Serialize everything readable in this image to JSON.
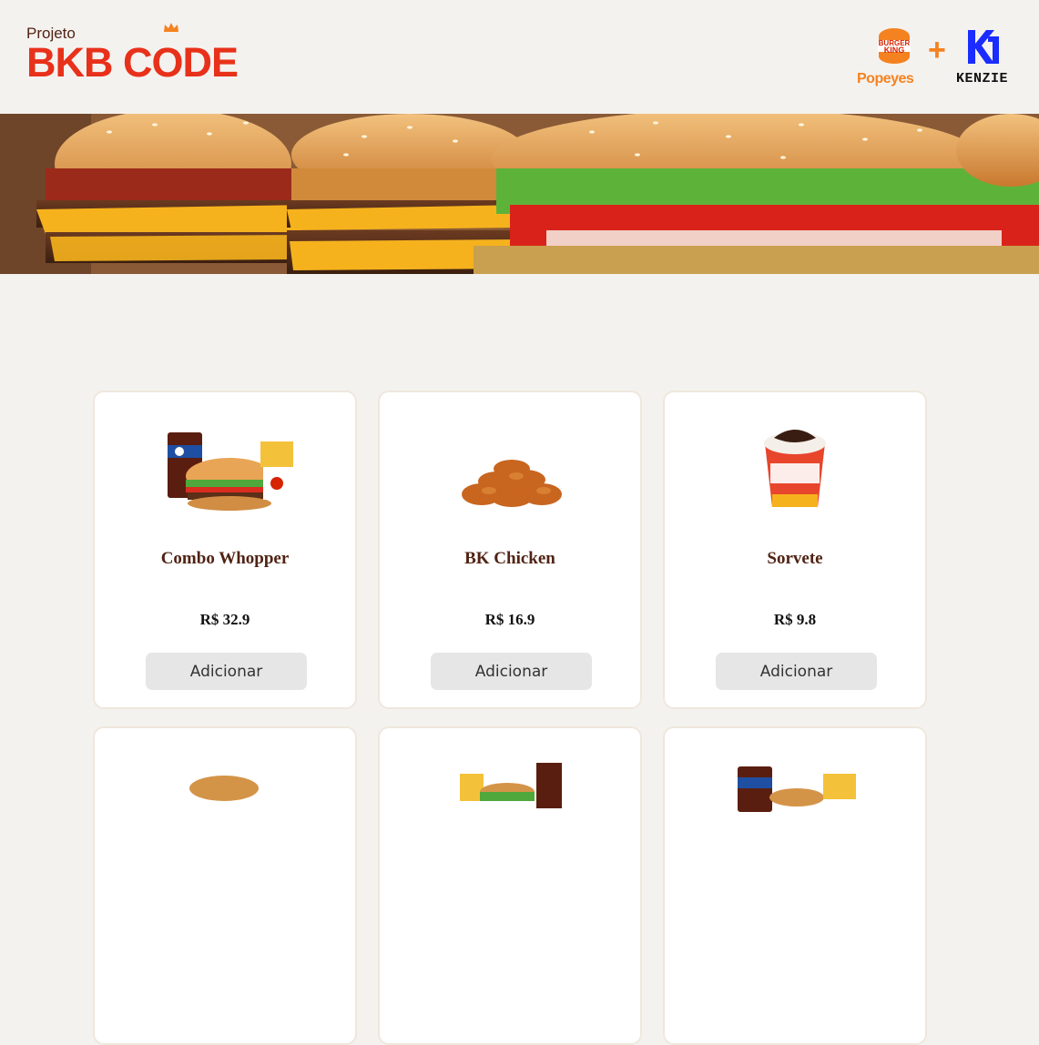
{
  "header": {
    "brand_small": "Projeto",
    "brand_large": "BKB CODE",
    "partner_bk": "BURGER KING",
    "partner_popeyes": "Popeyes",
    "partner_plus": "+",
    "partner_kenzie": "KENZIE"
  },
  "products": [
    {
      "name": "Combo Whopper",
      "price": "R$ 32.9",
      "button": "Adicionar",
      "image": "combo-whopper-image"
    },
    {
      "name": "BK Chicken",
      "price": "R$ 16.9",
      "button": "Adicionar",
      "image": "chicken-nuggets-image"
    },
    {
      "name": "Sorvete",
      "price": "R$ 9.8",
      "button": "Adicionar",
      "image": "sundae-image"
    },
    {
      "name": "",
      "price": "",
      "button": "",
      "image": "burger-image"
    },
    {
      "name": "",
      "price": "",
      "button": "",
      "image": "combo-image"
    },
    {
      "name": "",
      "price": "",
      "button": "",
      "image": "combo-pepsi-image"
    }
  ],
  "colors": {
    "accent": "#e8311a",
    "brown": "#502314",
    "orange": "#f58220",
    "background": "#f4f2ef"
  }
}
